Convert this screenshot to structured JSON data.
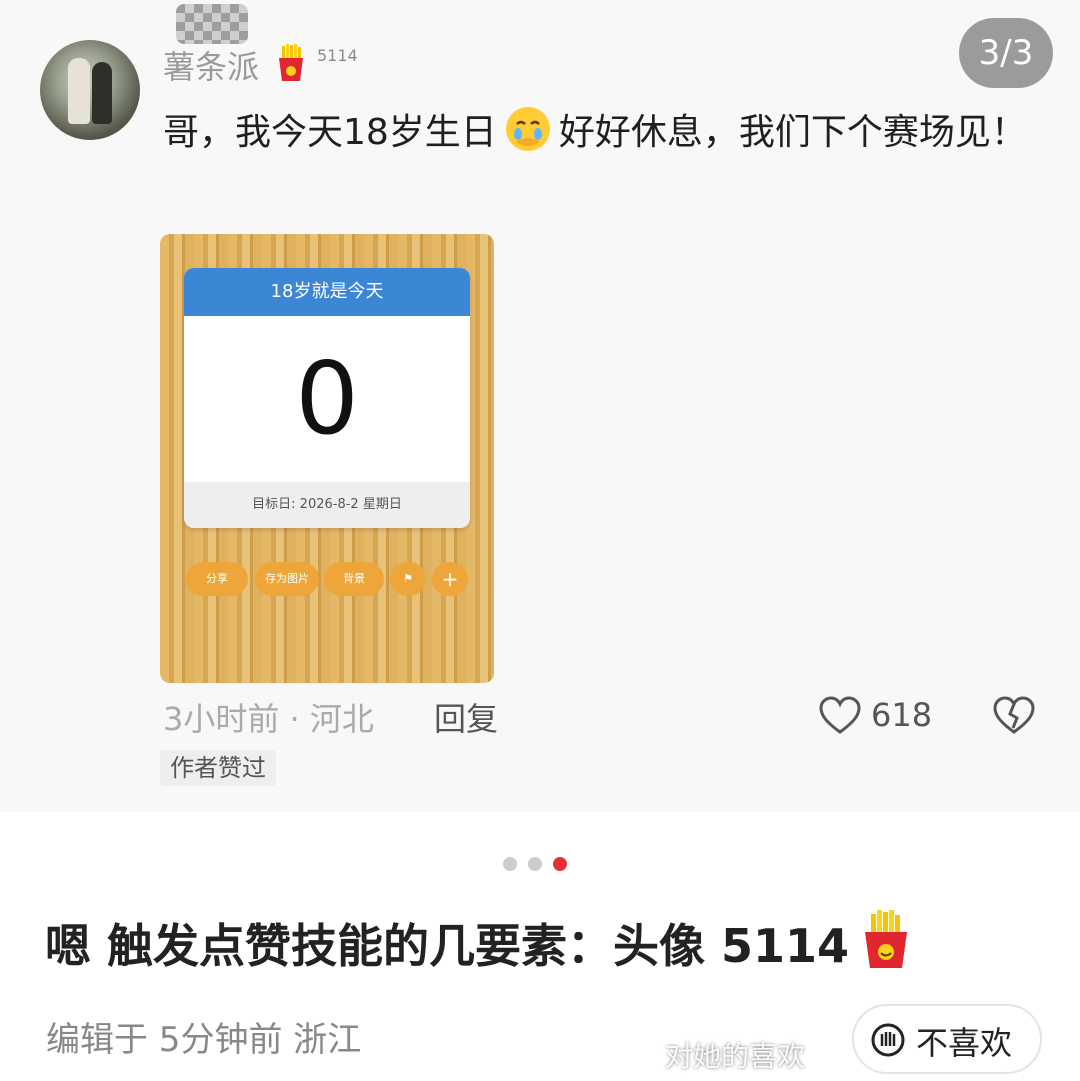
{
  "comment": {
    "username": "薯条派",
    "level": "5114",
    "page_indicator": "3/3",
    "text_part1": "哥，我今天18岁生日",
    "text_part2": "好好休息，我们下个赛场见！",
    "time_location": "3小时前 · 河北",
    "reply_label": "回复",
    "like_count": "618",
    "author_badge": "作者赞过"
  },
  "countdown_image": {
    "header": "18岁就是今天",
    "number": "0",
    "target_date": "目标日: 2026-8-2 星期日",
    "buttons": [
      "分享",
      "存为图片",
      "背景",
      "",
      "+"
    ]
  },
  "carousel": {
    "total": 3,
    "active_index": 2,
    "inactive_color": "#cccccc",
    "active_color": "#e8303b"
  },
  "post": {
    "title": "嗯 触发点赞技能的几要素：头像 5114",
    "edited": "编辑于 5分钟前 浙江",
    "dislike_label": "不喜欢"
  },
  "watermark": "对她的喜欢",
  "icons": {
    "fries": "fries-icon",
    "crying_face": "crying-face-icon",
    "like": "heart-outline-icon",
    "dislike": "broken-heart-icon"
  }
}
